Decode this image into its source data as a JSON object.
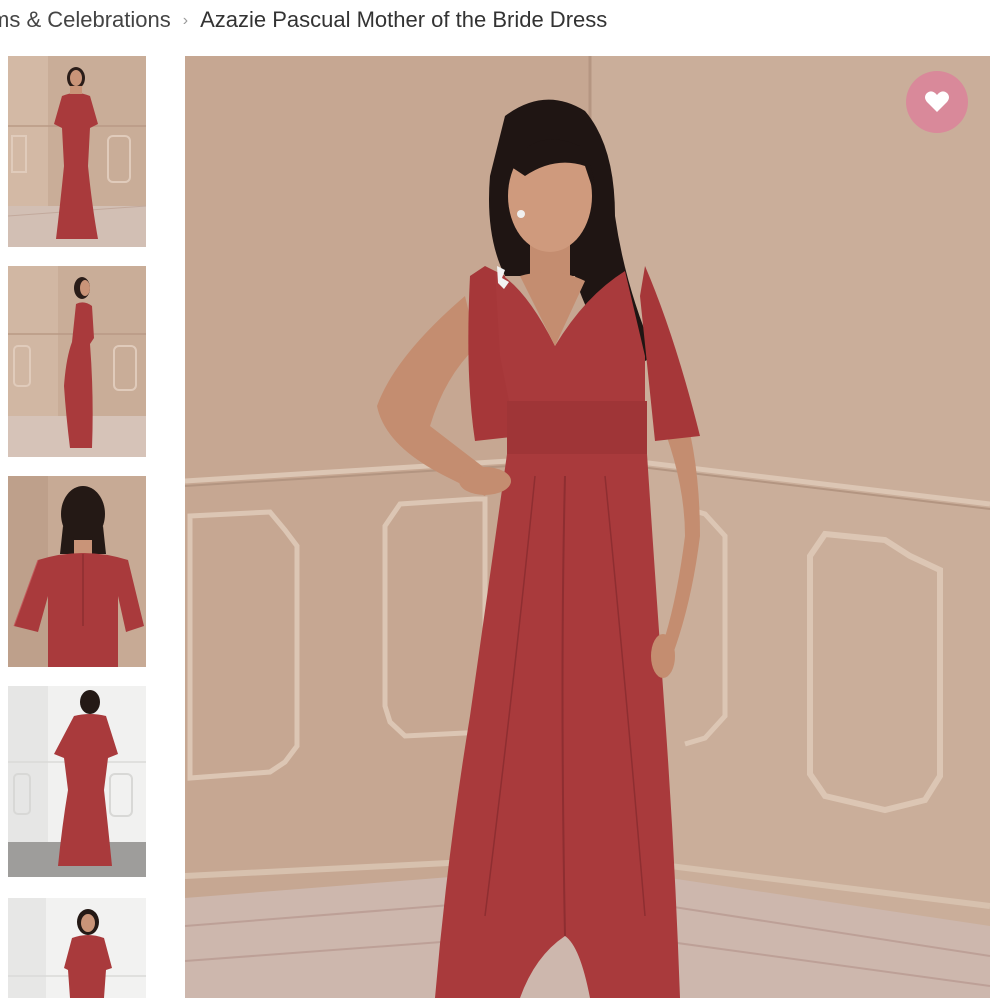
{
  "breadcrumb": {
    "parent_label": "ms & Celebrations",
    "separator": "›",
    "current_label": "Azazie Pascual Mother of the Bride Dress"
  },
  "gallery": {
    "thumbnails": [
      {
        "icon": "dress-front-view-image"
      },
      {
        "icon": "dress-side-view-image"
      },
      {
        "icon": "dress-back-view-image"
      },
      {
        "icon": "dress-back-studio-image"
      },
      {
        "icon": "dress-front-studio-image"
      }
    ],
    "main_image": {
      "icon": "model-in-red-dress-image"
    },
    "wishlist_icon": "heart-icon"
  },
  "colors": {
    "dress": "#a93a3c",
    "wall": "#c8ab96",
    "wishlist_bg": "#d9899a"
  }
}
